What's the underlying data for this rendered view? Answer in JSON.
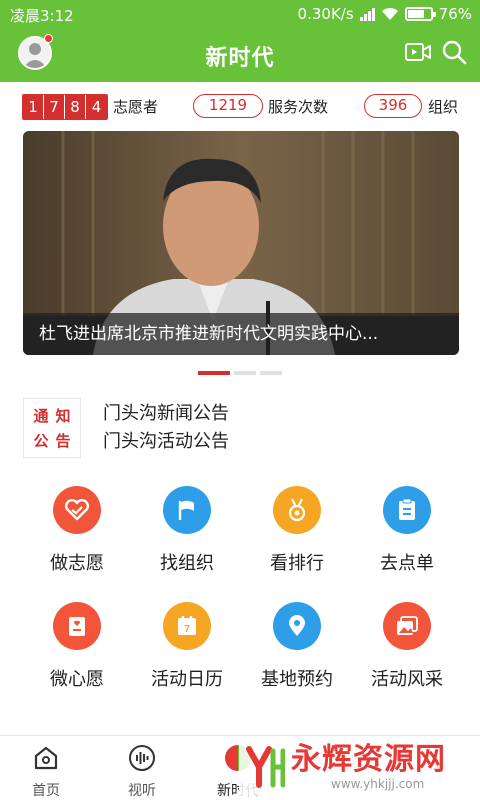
{
  "status_bar": {
    "time": "凌晨3:12",
    "network_speed": "0.30K/s",
    "battery": "76%",
    "battery_level": 0.76
  },
  "app_bar": {
    "title": "新时代",
    "icons": [
      "avatar",
      "video-icon",
      "search-icon"
    ]
  },
  "stats": {
    "volunteer_digits": [
      "1",
      "7",
      "8",
      "4"
    ],
    "volunteer_label": "志愿者",
    "service_count": "1219",
    "service_label": "服务次数",
    "org_count": "396",
    "org_label": "组织"
  },
  "banner": {
    "caption": "杜飞进出席北京市推进新时代文明实践中心...",
    "slide_count": 3,
    "active_slide": 1
  },
  "notice": {
    "badge_chars": [
      "通",
      "知",
      "公",
      "告"
    ],
    "items": [
      "门头沟新闻公告",
      "门头沟活动公告"
    ]
  },
  "grid": {
    "items": [
      {
        "label": "做志愿",
        "icon": "heart-icon",
        "color": "#f2553a"
      },
      {
        "label": "找组织",
        "icon": "flag-icon",
        "color": "#2f9ee8"
      },
      {
        "label": "看排行",
        "icon": "medal-icon",
        "color": "#f6a623"
      },
      {
        "label": "去点单",
        "icon": "clipboard-icon",
        "color": "#2f9ee8"
      },
      {
        "label": "微心愿",
        "icon": "wish-card-icon",
        "color": "#f2553a"
      },
      {
        "label": "活动日历",
        "icon": "calendar-icon",
        "color": "#f6a623"
      },
      {
        "label": "基地预约",
        "icon": "location-pin-icon",
        "color": "#2f9ee8"
      },
      {
        "label": "活动风采",
        "icon": "photos-icon",
        "color": "#f2553a"
      }
    ]
  },
  "bottom_nav": {
    "items": [
      {
        "label": "首页",
        "icon": "home-icon"
      },
      {
        "label": "视听",
        "icon": "audio-icon"
      },
      {
        "label": "新时代",
        "icon": "new-era-icon"
      }
    ]
  },
  "watermark": {
    "text": "永辉资源网",
    "url": "www.yhkjjj.com"
  },
  "colors": {
    "primary_green": "#67c23a",
    "accent_red": "#d32f2f"
  }
}
